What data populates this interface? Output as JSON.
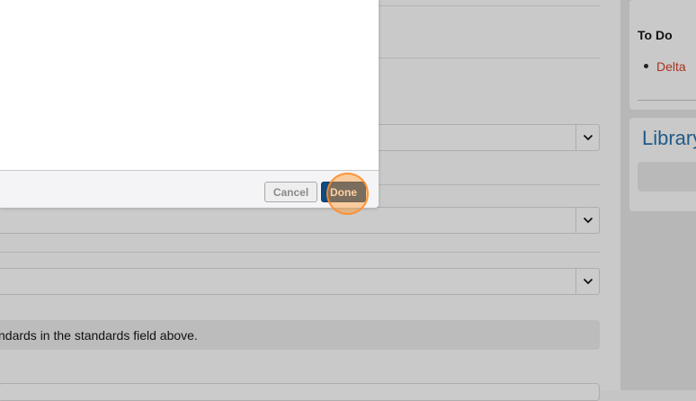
{
  "form": {
    "info_text": "ndards in the standards field above."
  },
  "sidebar": {
    "todo_title": "To Do",
    "todo_items": [
      {
        "label": "Delta"
      }
    ],
    "library_title": "Library"
  },
  "modal": {
    "cancel_label": "Cancel",
    "done_label": "Done"
  },
  "colors": {
    "accent_blue": "#0f4a80",
    "link_red": "#a8321f",
    "heading_blue": "#1f5a8a",
    "click_highlight": "#ff9933"
  },
  "icons": {
    "select_arrow": "chevron-down-icon"
  }
}
